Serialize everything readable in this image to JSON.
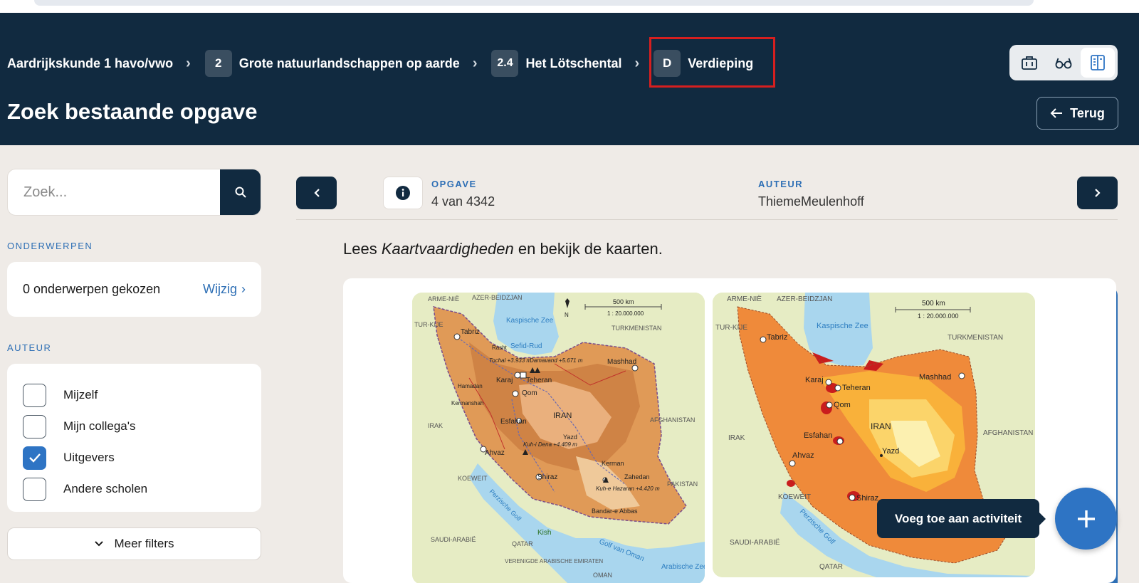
{
  "breadcrumb": [
    {
      "badge": "",
      "label": "Aardrijkskunde 1 havo/vwo"
    },
    {
      "badge": "2",
      "label": "Grote natuurlandschappen op aarde"
    },
    {
      "badge": "2.4",
      "label": "Het Lötschental"
    },
    {
      "badge": "D",
      "label": "Verdieping"
    }
  ],
  "page_title": "Zoek bestaande opgave",
  "back_label": "Terug",
  "toolbar": {
    "icons": [
      "briefcase-icon",
      "glasses-icon",
      "book-columns-icon"
    ],
    "active": "book-columns-icon"
  },
  "search": {
    "placeholder": "Zoek..."
  },
  "filters": {
    "onderwerpen_label": "ONDERWERPEN",
    "onderwerpen_value": "0 onderwerpen gekozen",
    "wijzig_label": "Wijzig",
    "auteur_label": "AUTEUR",
    "auteur_options": [
      {
        "label": "Mijzelf",
        "checked": false
      },
      {
        "label": "Mijn collega's",
        "checked": false
      },
      {
        "label": "Uitgevers",
        "checked": true
      },
      {
        "label": "Andere scholen",
        "checked": false
      }
    ],
    "meer_filters": "Meer filters"
  },
  "item": {
    "opgave_label": "OPGAVE",
    "opgave_value": "4 van 4342",
    "auteur_label": "AUTEUR",
    "auteur_value": "ThiemeMeulenhoff",
    "instruction_before": "Lees ",
    "instruction_em": "Kaartvaardigheden",
    "instruction_after": " en bekijk de kaarten."
  },
  "map1": {
    "labels": [
      "ARME-NIË",
      "AZER-BEIDZJAN",
      "TUR-KIJE",
      "Kaspische Zee",
      "Sefid-Rud",
      "TURKMENISTAN",
      "Tabriz",
      "Rasht",
      "Tochal +3.933 m",
      "Damavand +5.671 m",
      "Karaj",
      "Teheran",
      "Mashhad",
      "Hamadan",
      "Qom",
      "Kermanshah",
      "IRAN",
      "IRAK",
      "Esfahan",
      "AFGHANISTAN",
      "Yazd",
      "Kuh-i Dena +4.409 m",
      "Ahvaz",
      "Kerman",
      "Shiraz",
      "Zahedan",
      "Kuh-e Hazaran +4.420 m",
      "KOEWEIT",
      "PAKISTAN",
      "Perzische Golf",
      "Bandar-e Abbas",
      "Kish",
      "SAUDI-ARABIË",
      "QATAR",
      "Golf van Oman",
      "VERENIGDE ARABISCHE EMIRATEN",
      "OMAN",
      "Arabische Zee",
      "N"
    ],
    "scale": "500 km",
    "ratio": "1 : 20.000.000"
  },
  "map2": {
    "labels": [
      "ARME-NIË",
      "AZER-BEIDZJAN",
      "TUR-KIJE",
      "Kaspische Zee",
      "TURKMENISTAN",
      "Tabriz",
      "Karaj",
      "Teheran",
      "Mashhad",
      "Qom",
      "IRAN",
      "IRAK",
      "Esfahan",
      "AFGHANISTAN",
      "Ahvaz",
      "Yazd",
      "KOEWEIT",
      "Shiraz",
      "Perzische Golf",
      "SAUDI-ARABIË",
      "QATAR"
    ],
    "scale": "500 km",
    "ratio": "1 : 20.000.000"
  },
  "fab": {
    "tooltip": "Voeg toe aan activiteit"
  },
  "colors": {
    "navy": "#112a40",
    "accent": "#2e74c4",
    "highlight": "#d61f1f"
  }
}
